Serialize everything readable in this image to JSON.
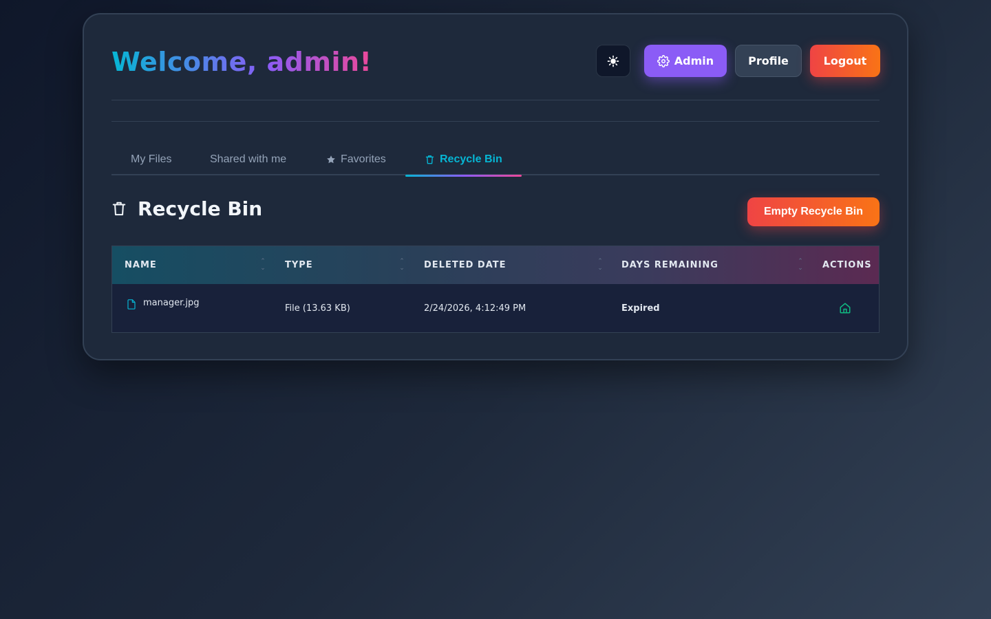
{
  "header": {
    "welcome": "Welcome, admin!",
    "theme_icon": "sun-icon",
    "admin_label": "Admin",
    "profile_label": "Profile",
    "logout_label": "Logout"
  },
  "tabs": [
    {
      "label": "My Files",
      "icon": "",
      "active": false
    },
    {
      "label": "Shared with me",
      "icon": "",
      "active": false
    },
    {
      "label": "Favorites",
      "icon": "star-icon",
      "active": false
    },
    {
      "label": "Recycle Bin",
      "icon": "trash-icon",
      "active": true
    }
  ],
  "section": {
    "title": "Recycle Bin",
    "empty_button": "Empty Recycle Bin"
  },
  "table": {
    "columns": [
      "NAME",
      "TYPE",
      "DELETED DATE",
      "DAYS REMAINING",
      "ACTIONS"
    ],
    "rows": [
      {
        "name": "manager.jpg",
        "type": "File (13.63 KB)",
        "deleted_date": "2/24/2026, 4:12:49 PM",
        "days_remaining": "Expired",
        "action_icon": "restore-icon"
      }
    ]
  },
  "colors": {
    "accent_cyan": "#06b6d4",
    "accent_purple": "#8b5cf6",
    "accent_pink": "#ec4899",
    "danger_red": "#ef4444",
    "danger_orange": "#f97316",
    "restore_green": "#10b981",
    "card_bg": "#1e293b"
  }
}
